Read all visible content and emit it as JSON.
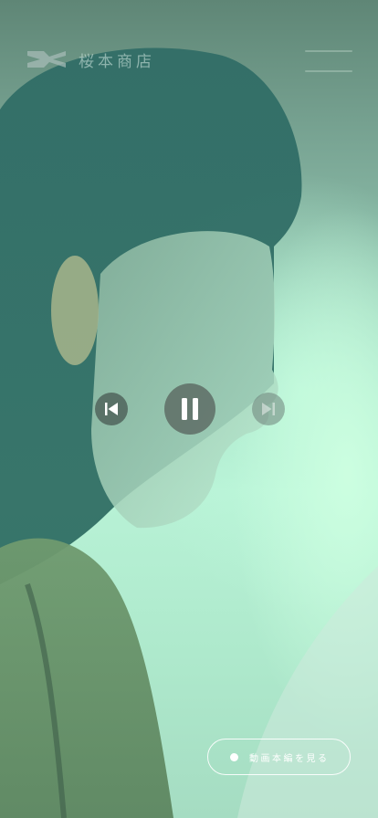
{
  "header": {
    "brand_name": "桜本商店",
    "logo_icon": "brand-mark-icon",
    "menu_icon": "hamburger-menu-icon"
  },
  "player": {
    "prev_icon": "skip-previous-icon",
    "pause_icon": "pause-icon",
    "next_icon": "skip-next-icon"
  },
  "cta": {
    "label": "動画本編を見る",
    "dot_icon": "dot-icon"
  },
  "colors": {
    "backdrop_dark": "#5f8676",
    "backdrop_light": "#b8f2d6",
    "control_fill": "#607068",
    "cta_border": "#ffffff"
  }
}
